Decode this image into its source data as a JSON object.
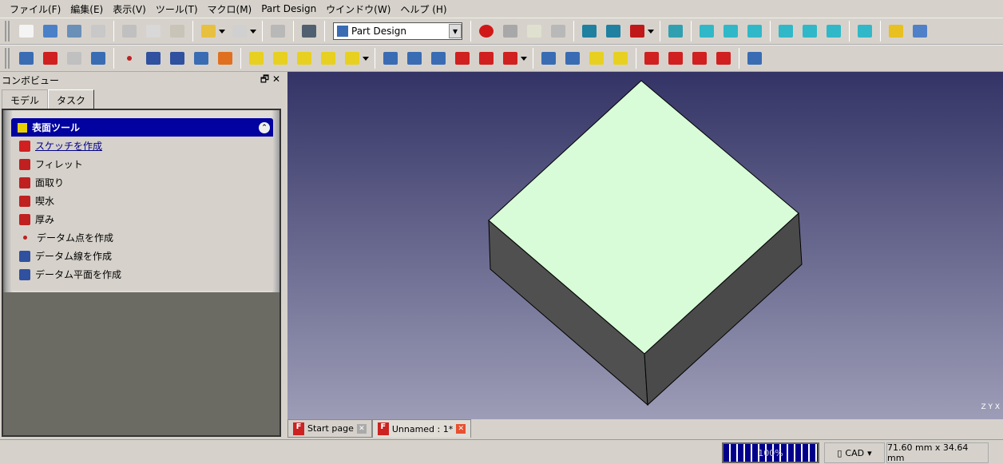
{
  "menu": [
    "ファイル(F)",
    "編集(E)",
    "表示(V)",
    "ツール(T)",
    "マクロ(M)",
    "Part Design",
    "ウインドウ(W)",
    "ヘルプ (H)"
  ],
  "toolbar1": [
    [
      "new-document",
      "#f4f4f4"
    ],
    [
      "open",
      "#4a80c8"
    ],
    [
      "save",
      "#6a90b8"
    ],
    [
      "print",
      "#c8c8c8"
    ],
    "|",
    [
      "cut",
      "#c0c0c0"
    ],
    [
      "copy",
      "#d8d8d8"
    ],
    [
      "paste",
      "#c8c4b8"
    ],
    "|",
    [
      "undo",
      "#e8c040"
    ],
    "v",
    [
      "redo",
      "#d0d0d0"
    ],
    "v",
    "|",
    [
      "refresh",
      "#b8b8b8"
    ],
    "|",
    [
      "whats-this",
      "#506070"
    ],
    "|",
    "combo",
    "|",
    [
      "macro-record",
      "#d01818"
    ],
    [
      "macro-stop",
      "#a8a8a8"
    ],
    [
      "macro-edit",
      "#e0e0d0"
    ],
    [
      "macro-run",
      "#b8b8b8"
    ],
    "|",
    [
      "fit-all",
      "#2080a0"
    ],
    [
      "fit-selection",
      "#2080a0"
    ],
    [
      "draw-style",
      "#c01818"
    ],
    "v",
    "|",
    [
      "view-isometric",
      "#30a0b0"
    ],
    "|",
    [
      "view-front",
      "#30b8c8"
    ],
    [
      "view-top",
      "#30b8c8"
    ],
    [
      "view-right",
      "#30b8c8"
    ],
    "|",
    [
      "view-rear",
      "#30b8c8"
    ],
    [
      "view-bottom",
      "#30b8c8"
    ],
    [
      "view-left",
      "#30b8c8"
    ],
    "|",
    [
      "measure",
      "#30b8c8"
    ],
    "|",
    [
      "part",
      "#e8c020"
    ],
    [
      "group",
      "#5080c8"
    ]
  ],
  "toolbar2": [
    [
      "create-body",
      "#3a6cb4"
    ],
    [
      "create-sketch",
      "#d02020"
    ],
    [
      "validate-sketch",
      "#c0c0c0"
    ],
    [
      "map-sketch",
      "#3a6cb4"
    ],
    "|",
    [
      "datum-point",
      "#c02020"
    ],
    [
      "datum-line",
      "#3050a0"
    ],
    [
      "datum-plane",
      "#3050a0"
    ],
    [
      "shape-binder",
      "#3a6cb4"
    ],
    [
      "clone",
      "#e07020"
    ],
    "|",
    [
      "pad",
      "#e8d020"
    ],
    [
      "revolution",
      "#e8d020"
    ],
    [
      "additive-loft",
      "#e8d020"
    ],
    [
      "additive-pipe",
      "#e8d020"
    ],
    [
      "additive-primitive",
      "#e8d020"
    ],
    "v",
    "|",
    [
      "pocket",
      "#3a6cb4"
    ],
    [
      "hole",
      "#3a6cb4"
    ],
    [
      "groove",
      "#3a6cb4"
    ],
    [
      "subtractive-loft",
      "#d02020"
    ],
    [
      "subtractive-pipe",
      "#d02020"
    ],
    [
      "subtractive-primitive",
      "#d02020"
    ],
    "v",
    "|",
    [
      "mirrored",
      "#3a6cb4"
    ],
    [
      "linear-pattern",
      "#3a6cb4"
    ],
    [
      "polar-pattern",
      "#e8d020"
    ],
    [
      "multi-transform",
      "#e8d020"
    ],
    "|",
    [
      "fillet",
      "#d02020"
    ],
    [
      "chamfer",
      "#d02020"
    ],
    [
      "draft",
      "#d02020"
    ],
    [
      "thickness",
      "#d02020"
    ],
    "|",
    [
      "boolean",
      "#3a6cb4"
    ]
  ],
  "workbench": "Part Design",
  "combo_view": {
    "title": "コンボビュー",
    "float": "🗗",
    "close": "✕",
    "tabs": [
      "モデル",
      "タスク"
    ],
    "active_tab": "タスク"
  },
  "task_panel": {
    "title": "表面ツール",
    "collapse": "⌃",
    "items": [
      {
        "label": "スケッチを作成",
        "icon": "create-sketch",
        "color": "#d02020",
        "link": true
      },
      {
        "label": "フィレット",
        "icon": "fillet",
        "color": "#c02020"
      },
      {
        "label": "面取り",
        "icon": "chamfer",
        "color": "#c02020"
      },
      {
        "label": "喫水",
        "icon": "draft",
        "color": "#c02020"
      },
      {
        "label": "厚み",
        "icon": "thickness",
        "color": "#c02020"
      },
      {
        "label": "データム点を作成",
        "icon": "datum-point",
        "color": "#c02020"
      },
      {
        "label": "データム線を作成",
        "icon": "datum-line",
        "color": "#3050a0"
      },
      {
        "label": "データム平面を作成",
        "icon": "datum-plane",
        "color": "#3050a0"
      }
    ]
  },
  "viewport": {
    "top_color": "#d8fcd8",
    "side_color": "#505050",
    "axis": "Z Y X"
  },
  "doc_tabs": [
    {
      "label": "Start page",
      "active": false
    },
    {
      "label": "Unnamed : 1*",
      "active": true
    }
  ],
  "status": {
    "progress_text": "100%",
    "progress": 100,
    "nav_style": "CAD",
    "dimensions": "71.60 mm x 34.64 mm"
  }
}
